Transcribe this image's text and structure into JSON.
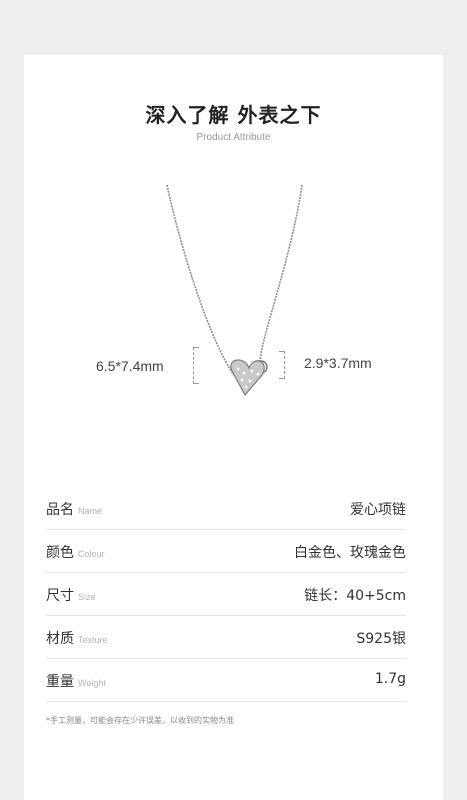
{
  "header": {
    "title": "深入了解 外表之下",
    "subtitle": "Product Attribute"
  },
  "dimensions": {
    "left": "6.5*7.4mm",
    "right": "2.9*3.7mm"
  },
  "attributes": [
    {
      "label": "品名",
      "label_en": "Name",
      "value": "爱心项链"
    },
    {
      "label": "颜色",
      "label_en": "Colour",
      "value": "白金色、玫瑰金色"
    },
    {
      "label": "尺寸",
      "label_en": "Size",
      "value": "链长：40+5cm"
    },
    {
      "label": "材质",
      "label_en": "Texture",
      "value": "S925银"
    },
    {
      "label": "重量",
      "label_en": "Weight",
      "value": "1.7g"
    }
  ],
  "note": "*手工测量，可能会存在少许误差，以收到的实物为准"
}
